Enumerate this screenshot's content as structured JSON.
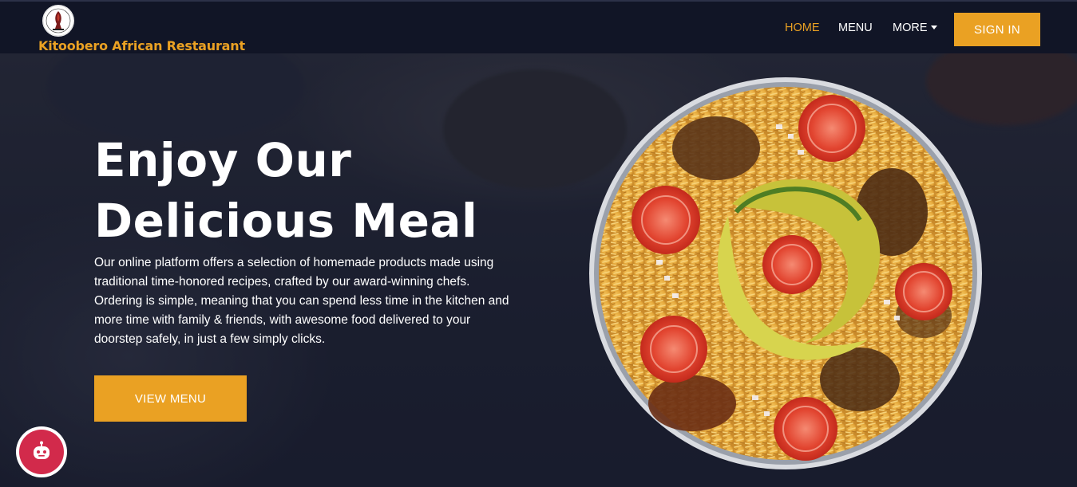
{
  "header": {
    "brand_name": "Kitoobero African Restaurant",
    "logo_icon": "restaurant-logo-icon",
    "nav": [
      {
        "label": "HOME",
        "active": true
      },
      {
        "label": "MENU",
        "active": false
      },
      {
        "label": "MORE",
        "active": false,
        "dropdown": true
      }
    ],
    "signin_label": "SIGN IN"
  },
  "hero": {
    "title_line1": "Enjoy Our",
    "title_line2": "Delicious Meal",
    "description": "Our online platform offers a selection of homemade products made using traditional time-honored recipes, crafted by our award-winning chefs. Ordering is simple, meaning that you can spend less time in the kitchen and more time with family & friends, with awesome food delivered to your doorstep safely, in just a few simply clicks.",
    "cta_label": "VIEW MENU",
    "image_icon": "food-dish-image"
  },
  "chatbot": {
    "icon": "chatbot-icon"
  },
  "colors": {
    "accent": "#eaa123",
    "navbar": "#111526",
    "chat": "#d22a4b"
  }
}
